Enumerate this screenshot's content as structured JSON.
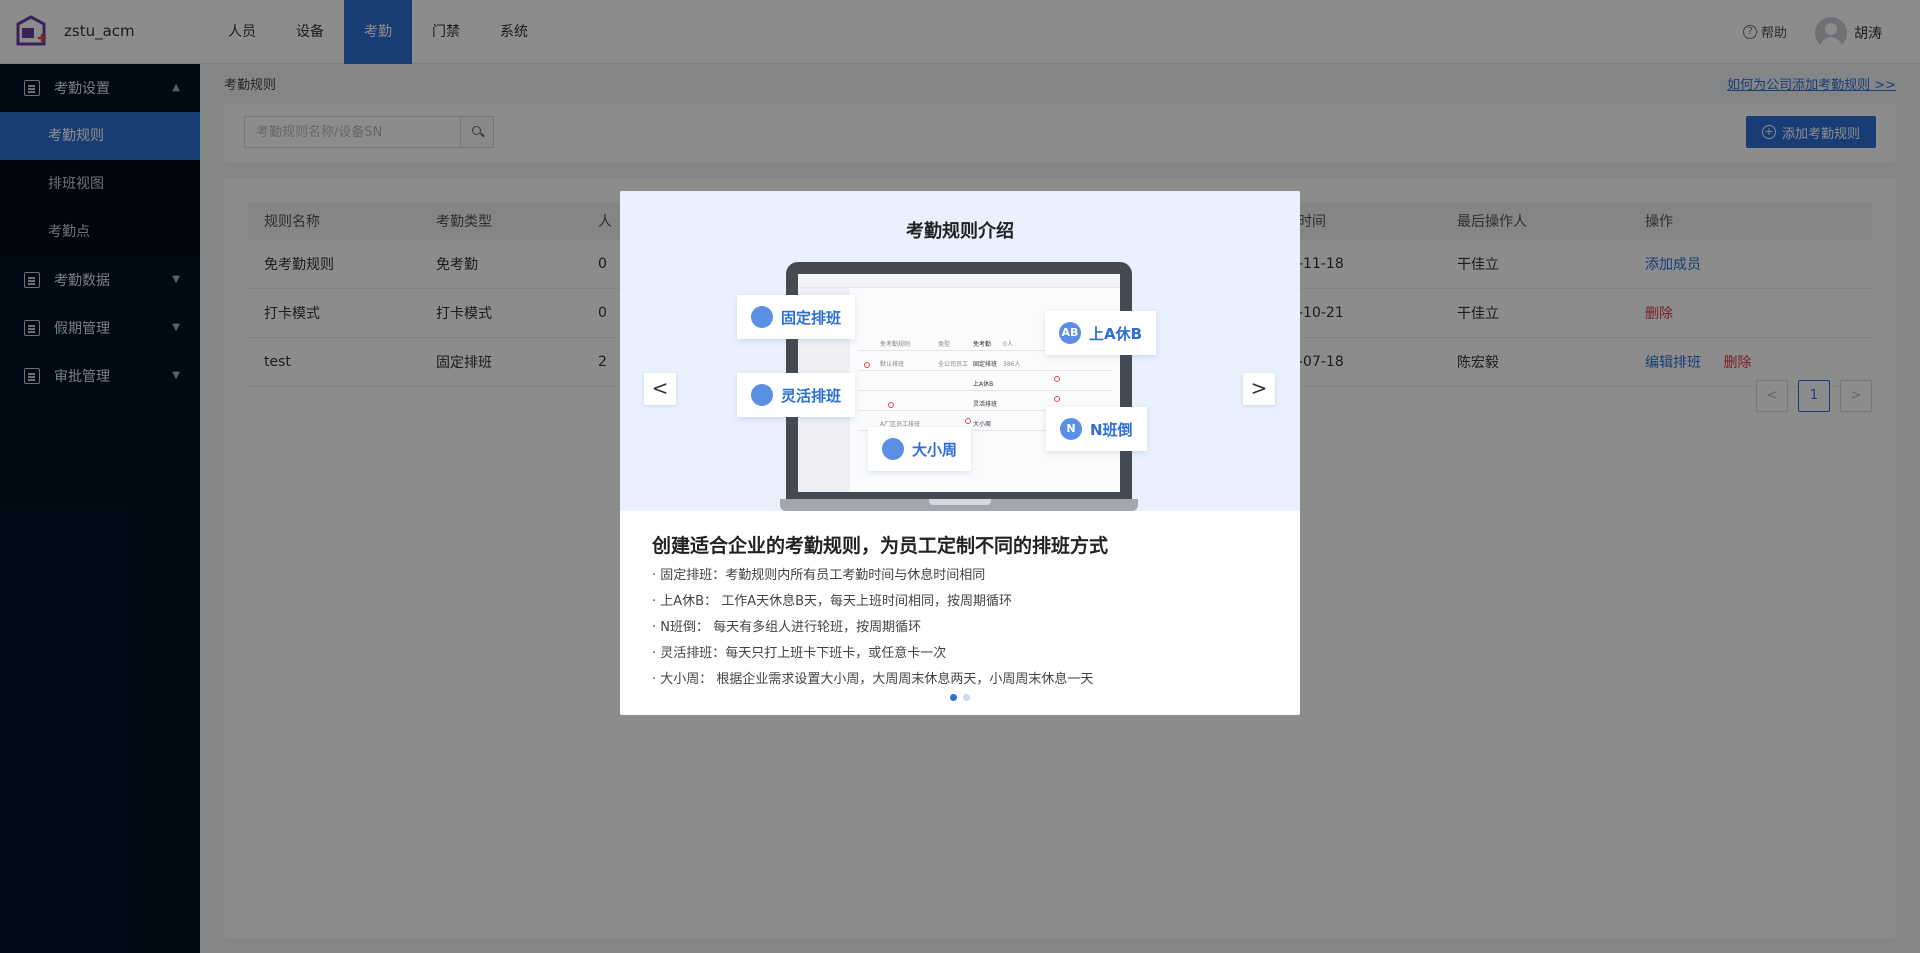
{
  "app": {
    "name": "zstu_acm"
  },
  "topnav": {
    "items": [
      "人员",
      "设备",
      "考勤",
      "门禁",
      "系统"
    ],
    "active_index": 2
  },
  "header": {
    "help": "帮助",
    "user": "胡涛"
  },
  "sidebar": {
    "groups": [
      {
        "label": "考勤设置",
        "expanded": true,
        "items": [
          "考勤规则",
          "排班视图",
          "考勤点"
        ],
        "active_item": "考勤规则"
      },
      {
        "label": "考勤数据"
      },
      {
        "label": "假期管理"
      },
      {
        "label": "审批管理"
      }
    ]
  },
  "content": {
    "breadcrumb": "考勤规则",
    "help_link": "如何为公司添加考勤规则 >>",
    "search": {
      "placeholder": "考勤规则名称/设备SN",
      "value": ""
    },
    "add_button": "添加考勤规则",
    "table": {
      "headers": [
        "规则名称",
        "考勤类型",
        "人",
        "时间",
        "最后操作人",
        "操作"
      ],
      "rows": [
        {
          "name": "免考勤规则",
          "type": "免考勤",
          "count": "0",
          "time": "-11-18",
          "operator": "干佳立",
          "actions": [
            "添加成员"
          ]
        },
        {
          "name": "打卡模式",
          "type": "打卡模式",
          "count": "0",
          "time": "-10-21",
          "operator": "干佳立",
          "actions": [
            "删除"
          ]
        },
        {
          "name": "test",
          "type": "固定排班",
          "count": "2",
          "time": "-07-18",
          "operator": "陈宏毅",
          "actions": [
            "编辑排班",
            "删除"
          ]
        }
      ]
    },
    "pagination": {
      "prev": "<",
      "current": "1",
      "next": ">"
    }
  },
  "modal": {
    "title": "考勤规则介绍",
    "tags": [
      "固定排班",
      "灵活排班",
      "大小周",
      "上A休B",
      "N班倒"
    ],
    "tag_icons": [
      "",
      "",
      "",
      "AB",
      "N"
    ],
    "screen_text": [
      "免考勤规则",
      "类型",
      "免考勤",
      "0人",
      "默认排班",
      "全公司员工",
      "固定排班",
      "386人",
      "上A休B",
      "灵活排班",
      "A厂区员工排班",
      "大小周"
    ],
    "headline": "创建适合企业的考勤规则，为员工定制不同的排班方式",
    "bullets": [
      "· 固定排班：考勤规则内所有员工考勤时间与休息时间相同",
      "· 上A休B：  工作A天休息B天，每天上班时间相同，按周期循环",
      "· N班倒：  每天有多组人进行轮班，按周期循环",
      "· 灵活排班：每天只打上班卡下班卡，或任意卡一次",
      "· 大小周：  根据企业需求设置大小周，大周周末休息两天，小周周末休息一天"
    ],
    "prev": "<",
    "next": ">",
    "slide_count": 2,
    "current_slide": 1
  }
}
